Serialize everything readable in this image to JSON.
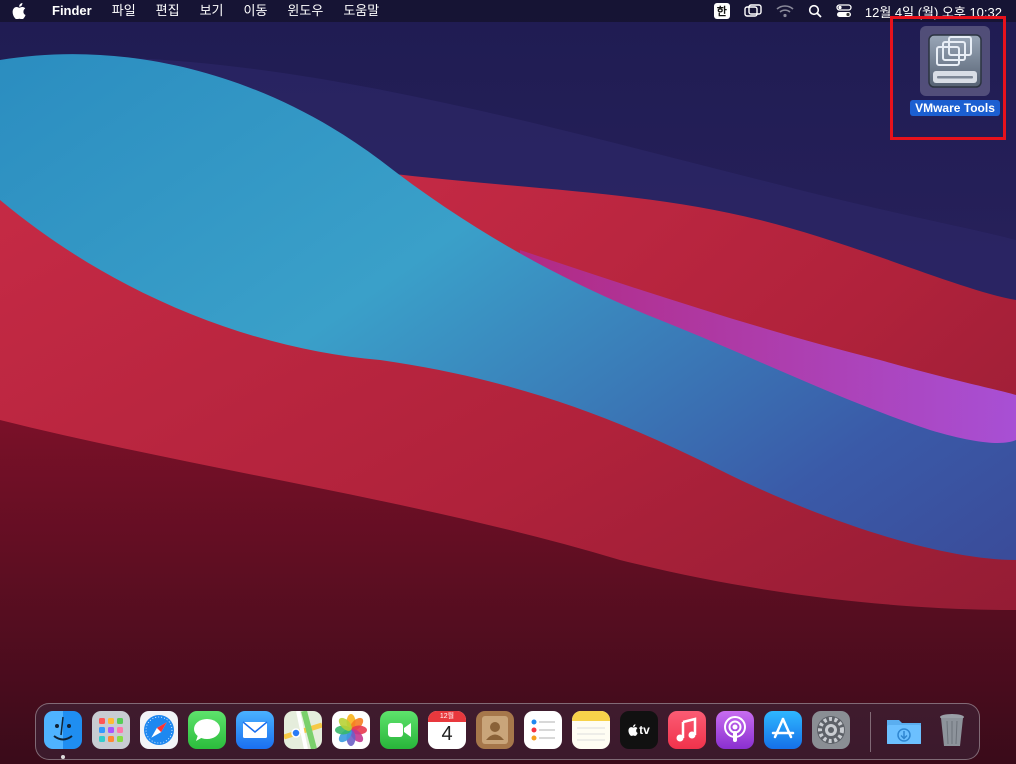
{
  "menubar": {
    "app_name": "Finder",
    "menus": [
      "파일",
      "편집",
      "보기",
      "이동",
      "윈도우",
      "도움말"
    ],
    "ime_label": "한",
    "clock": "12월 4일 (월) 오후  10:32",
    "status_icons": [
      "ime-icon",
      "screen-mirror-icon",
      "wifi-icon",
      "search-icon",
      "control-center-icon"
    ]
  },
  "desktop": {
    "icon_label": "VMware Tools",
    "highlight_color": "#e8121c"
  },
  "dock": {
    "calendar_month": "12월",
    "calendar_day": "4",
    "tv_label": "tv",
    "apps": [
      "Finder",
      "Launchpad",
      "Safari",
      "Messages",
      "Mail",
      "Maps",
      "Photos",
      "FaceTime",
      "Calendar",
      "Contacts",
      "Reminders",
      "Notes",
      "TV",
      "Music",
      "Podcasts",
      "App Store",
      "System Preferences",
      "Downloads",
      "Trash"
    ]
  }
}
